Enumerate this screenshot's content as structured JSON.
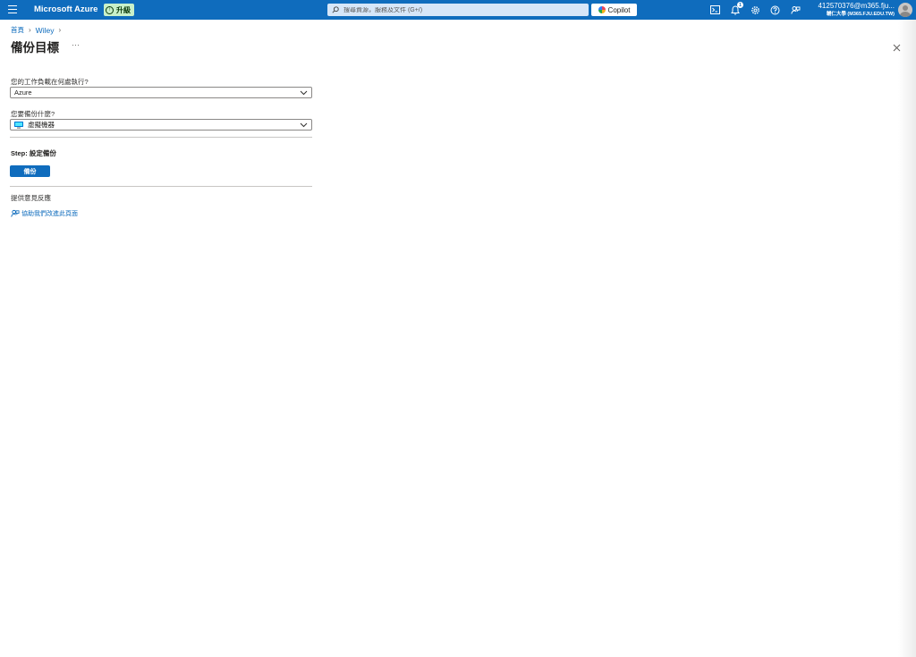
{
  "topbar": {
    "brand": "Microsoft Azure",
    "upgrade_label": "升級",
    "search_placeholder": "搜尋資源，服務及文件 (G+/)",
    "copilot_label": "Copilot",
    "notification_count": "1",
    "account_name": "412570376@m365.fju...",
    "account_org": "輔仁大學 (M365.FJU.EDU.TW)",
    "icons": [
      "cloud-shell-icon",
      "notification-icon",
      "settings-icon",
      "help-icon",
      "feedback-icon"
    ]
  },
  "breadcrumb": {
    "items": [
      "首頁",
      "Wiley"
    ]
  },
  "page": {
    "title": "備份目標",
    "more_label": "···"
  },
  "form": {
    "workload_label": "您的工作負載在何處執行?",
    "workload_value": "Azure",
    "backup_what_label": "您要備份什麼?",
    "backup_what_value": "虛擬機器",
    "step_label": "Step: 設定備份",
    "backup_button": "備份"
  },
  "feedback": {
    "title": "提供意見反應",
    "link": "協助我們改進此頁面"
  },
  "colors": {
    "topbar": "#0f6cbd",
    "link": "#0f6cbd",
    "upgrade_bg": "#c8f0c9",
    "search_bg": "#d6e6f8"
  }
}
